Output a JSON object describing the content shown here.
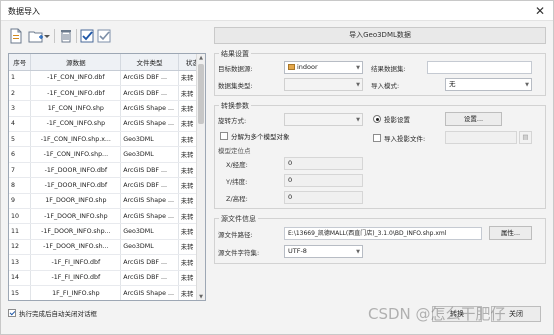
{
  "window": {
    "title": "数据导入",
    "close_glyph": "✕"
  },
  "toolbar": {
    "icons": [
      "add-file-icon",
      "add-folder-icon",
      "delete-icon",
      "select-all-icon",
      "invert-select-icon"
    ]
  },
  "table": {
    "headers": [
      "序号",
      "源数据",
      "文件类型",
      "状态"
    ],
    "rows": [
      [
        "1",
        "-1F_CON_INFO.dbf",
        "ArcGIS DBF ...",
        "未转"
      ],
      [
        "2",
        "-1F_CON_INFO.dbf",
        "ArcGIS DBF ...",
        "未转"
      ],
      [
        "3",
        "1F_CON_INFO.shp",
        "ArcGIS Shape ...",
        "未转"
      ],
      [
        "4",
        "-1F_CON_INFO.shp",
        "ArcGIS Shape ...",
        "未转"
      ],
      [
        "5",
        "-1F_CON_INFO.shp.x...",
        "Geo3DML",
        "未转"
      ],
      [
        "6",
        "-1F_CON_INFO.shp...",
        "Geo3DML",
        "未转"
      ],
      [
        "7",
        "-1F_DOOR_INFO.dbf",
        "ArcGIS DBF ...",
        "未转"
      ],
      [
        "8",
        "-1F_DOOR_INFO.dbf",
        "ArcGIS DBF ...",
        "未转"
      ],
      [
        "9",
        "1F_DOOR_INFO.shp",
        "ArcGIS Shape ...",
        "未转"
      ],
      [
        "10",
        "-1F_DOOR_INFO.shp",
        "ArcGIS Shape ...",
        "未转"
      ],
      [
        "11",
        "-1F_DOOR_INFO.shp...",
        "Geo3DML",
        "未转"
      ],
      [
        "12",
        "-1F_DOOR_INFO.sh...",
        "Geo3DML",
        "未转"
      ],
      [
        "13",
        "-1F_FI_INFO.dbf",
        "ArcGIS DBF ...",
        "未转"
      ],
      [
        "14",
        "-1F_FI_INFO.dbf",
        "ArcGIS DBF ...",
        "未转"
      ],
      [
        "15",
        "1F_FI_INFO.shp",
        "ArcGIS Shape ...",
        "未转"
      ],
      [
        "16",
        "-1F_FI_INFO.shp",
        "ArcGIS Shape ...",
        "未转"
      ]
    ]
  },
  "auto_close": {
    "label": "执行完成后自动关闭对话框",
    "checked": true
  },
  "import_button": "导入Geo3DML数据",
  "result_settings": {
    "title": "结果设置",
    "target_datasource_label": "目标数据源:",
    "target_datasource_value": "indoor",
    "result_dataset_label": "结果数据集:",
    "result_dataset_value": "",
    "dataset_type_label": "数据集类型:",
    "dataset_type_value": "",
    "import_mode_label": "导入模式:",
    "import_mode_value": "无"
  },
  "conversion": {
    "title": "转换参数",
    "rotation_label": "旋转方式:",
    "rotation_value": "",
    "split_label": "分解为多个模型对象",
    "split_checked": false,
    "position_title": "模型定位点",
    "x_label": "X/经度:",
    "x_value": "0",
    "y_label": "Y/纬度:",
    "y_value": "0",
    "z_label": "Z/高程:",
    "z_value": "0",
    "projection_label": "投影设置",
    "projection_button": "设置...",
    "import_proj_label": "导入投影文件:",
    "import_proj_value": ""
  },
  "source_info": {
    "title": "源文件信息",
    "path_label": "源文件路径:",
    "path_value": "E:\\13669_凯德MALL(西直门店)_3.1.0\\BD_INFO.shp.xml",
    "attr_button": "属性...",
    "charset_label": "源文件字符集:",
    "charset_value": "UTF-8"
  },
  "bottom": {
    "convert_button": "转换",
    "close_button": "关闭"
  },
  "watermark": "CSDN @怎么干肥仔"
}
